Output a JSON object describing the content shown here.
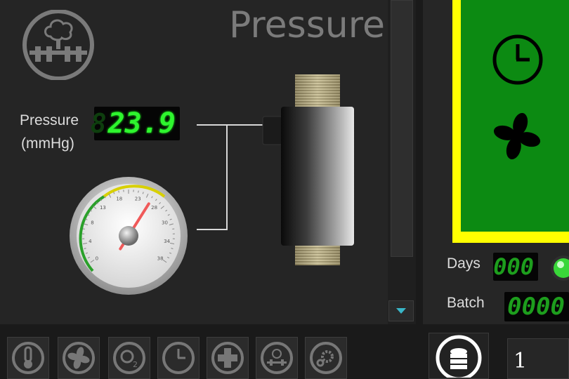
{
  "header": {
    "title": "Pressure"
  },
  "sensor": {
    "label_line1": "Pressure",
    "label_line2": "(mmHg)",
    "readout": "23.9",
    "readout_ghost": "8"
  },
  "gauge": {
    "ticks": [
      "0",
      "4",
      "8",
      "13",
      "18",
      "23",
      "28",
      "30",
      "34",
      "38"
    ],
    "value": 23.9,
    "max": 38
  },
  "right_panel": {
    "days_label": "Days",
    "days_value": "000",
    "batch_label": "Batch",
    "batch_value": "0000",
    "screen_color": "#0c8a12",
    "screen_border": "#ffff00",
    "status_led_color": "#39d739"
  },
  "toolbar": {
    "buttons": [
      "thermometer-icon",
      "fan-icon",
      "o2-icon",
      "clock-icon",
      "plus-icon",
      "pressure-icon",
      "gear-icon"
    ],
    "page_number": "1"
  },
  "colors": {
    "accent": "#2ef52e",
    "panel": "#252525"
  }
}
